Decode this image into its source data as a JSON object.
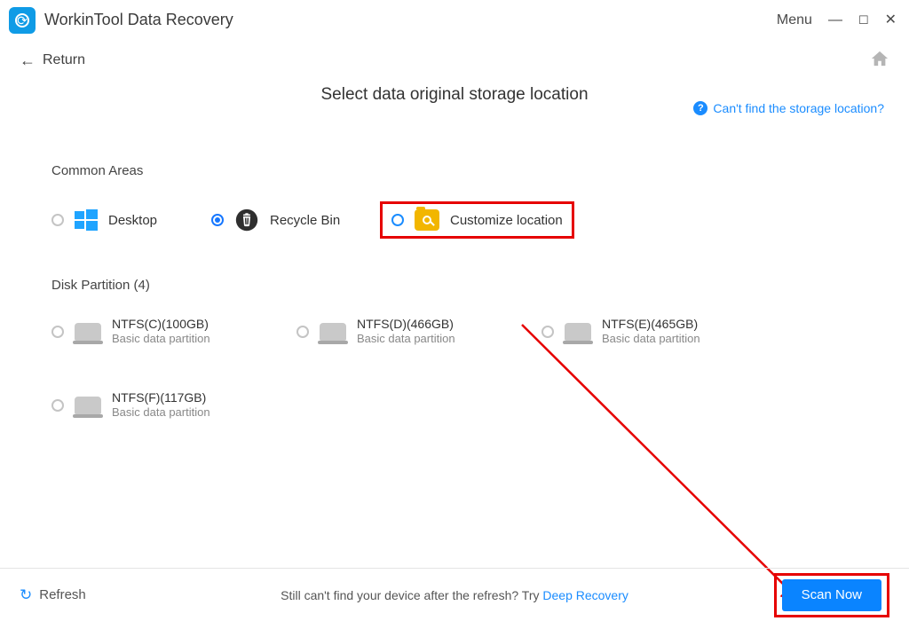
{
  "titlebar": {
    "app_title": "WorkinTool Data Recovery",
    "menu_label": "Menu"
  },
  "subheader": {
    "return_label": "Return"
  },
  "page": {
    "title": "Select data original storage location",
    "help_link": "Can't find the storage location?",
    "common_areas_label": "Common Areas",
    "disk_partition_label": "Disk Partition  (4)"
  },
  "common_areas": {
    "desktop": "Desktop",
    "recycle_bin": "Recycle Bin",
    "customize": "Customize location",
    "selected": "recycle_bin"
  },
  "disks": [
    {
      "name": "NTFS(C)(100GB)",
      "desc": "Basic data partition"
    },
    {
      "name": "NTFS(D)(466GB)",
      "desc": "Basic data partition"
    },
    {
      "name": "NTFS(E)(465GB)",
      "desc": "Basic data partition"
    },
    {
      "name": "NTFS(F)(117GB)",
      "desc": "Basic data partition"
    }
  ],
  "footer": {
    "refresh_label": "Refresh",
    "hint_prefix": "Still can't find your device after the refresh? Try ",
    "deep_recovery": "Deep Recovery",
    "scan_now": "Scan Now"
  },
  "colors": {
    "accent_blue": "#1a8cff",
    "primary_button": "#0a84ff",
    "highlight_red": "#e60000"
  }
}
